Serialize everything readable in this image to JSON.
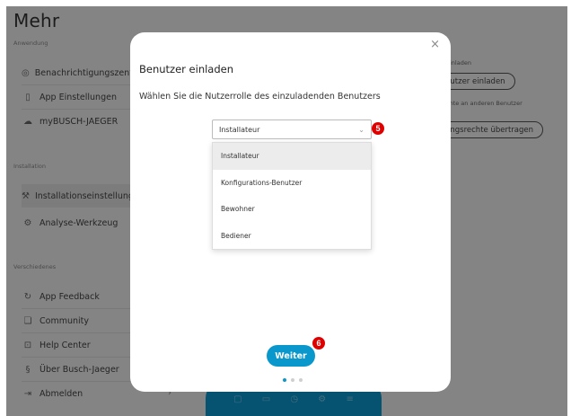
{
  "app": {
    "title": "Mehr",
    "sections": {
      "anwendung": "Anwendung",
      "installation": "Installation",
      "verschiedenes": "Verschiedenes"
    },
    "items": [
      {
        "label": "Benachrichtigungszentrale",
        "icon": "bell-icon"
      },
      {
        "label": "App Einstellungen",
        "icon": "phone-icon"
      },
      {
        "label": "myBUSCH-JAEGER",
        "icon": "cloud-icon"
      },
      {
        "label": "Installationseinstellungen",
        "icon": "wrench-icon"
      },
      {
        "label": "Analyse-Werkzeug",
        "icon": "gear-icon"
      },
      {
        "label": "App Feedback",
        "icon": "refresh-icon"
      },
      {
        "label": "Community",
        "icon": "chat-icon"
      },
      {
        "label": "Help Center",
        "icon": "help-icon"
      },
      {
        "label": "Über Busch-Jaeger",
        "icon": "info-icon"
      },
      {
        "label": "Abmelden",
        "icon": "logout-icon"
      }
    ],
    "right": {
      "einladen_label": "einladen",
      "einladen_button": "nutzer einladen",
      "rechte_label": "chte an anderen Benutzer",
      "rechte_button": "ungsrechte übertragen"
    }
  },
  "dialog": {
    "title": "Benutzer einladen",
    "subtitle": "Wählen Sie die Nutzerrolle des einzuladenden Benutzers",
    "select_value": "Installateur",
    "options": [
      "Installateur",
      "Konfigurations-Benutzer",
      "Bewohner",
      "Bediener"
    ],
    "next_button": "Weiter",
    "badge_select": "5",
    "badge_next": "6",
    "close_symbol": "×"
  },
  "colors": {
    "accent": "#0a97cc",
    "badge": "#e00000"
  }
}
